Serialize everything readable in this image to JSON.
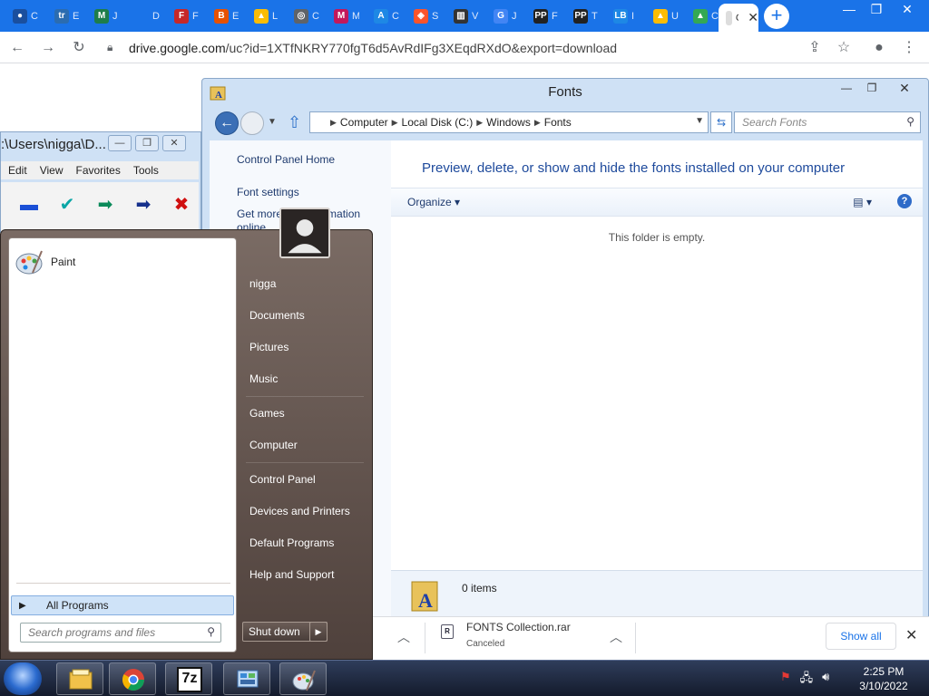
{
  "browser": {
    "tabs": [
      {
        "title": "C",
        "favicon": "gamepad-icon",
        "color": "#1a4f9e",
        "glyph": "●"
      },
      {
        "title": "E",
        "favicon": "trello-icon",
        "color": "#2b6cb0",
        "glyph": "tr"
      },
      {
        "title": "J",
        "favicon": "m-logo-icon",
        "color": "#1e7d4a",
        "glyph": "M"
      },
      {
        "title": "D",
        "favicon": "doc-icon",
        "color": "#1a73e8",
        "glyph": ""
      },
      {
        "title": "F",
        "favicon": "f-logo-icon",
        "color": "#c62828",
        "glyph": "F"
      },
      {
        "title": "E",
        "favicon": "b-logo-icon",
        "color": "#e65100",
        "glyph": "B"
      },
      {
        "title": "L",
        "favicon": "drive-icon",
        "color": "#fbbc04",
        "glyph": "▲"
      },
      {
        "title": "C",
        "favicon": "chrome-icon",
        "color": "#5f6368",
        "glyph": "◎"
      },
      {
        "title": "M",
        "favicon": "m-circle-icon",
        "color": "#c2185b",
        "glyph": "M"
      },
      {
        "title": "C",
        "favicon": "app-store-icon",
        "color": "#1e88e5",
        "glyph": "A"
      },
      {
        "title": "S",
        "favicon": "brave-icon",
        "color": "#fb542b",
        "glyph": "◈"
      },
      {
        "title": "V",
        "favicon": "museum-icon",
        "color": "#333333",
        "glyph": "▥"
      },
      {
        "title": "J",
        "favicon": "google-icon",
        "color": "#4285f4",
        "glyph": "G"
      },
      {
        "title": "F",
        "favicon": "pp-icon",
        "color": "#222222",
        "glyph": "PP"
      },
      {
        "title": "T",
        "favicon": "pp-icon-2",
        "color": "#222222",
        "glyph": "PP"
      },
      {
        "title": "I",
        "favicon": "lb-icon",
        "color": "#1e88e5",
        "glyph": "LB"
      },
      {
        "title": "U",
        "favicon": "drive-icon-2",
        "color": "#fbbc04",
        "glyph": "▲"
      },
      {
        "title": "C",
        "favicon": "drive-icon-3",
        "color": "#34a853",
        "glyph": "▲"
      },
      {
        "title": "G",
        "favicon": "active-tab-icon",
        "color": "#dddddd",
        "glyph": ""
      }
    ],
    "url_prefix": "drive.google.com",
    "url_rest": "/uc?id=1XTfNKRY770fgT6d5AvRdIFg3XEqdRXdO&export=download"
  },
  "explorer_bg": {
    "title": ":\\Users\\nigga\\D...",
    "menu": [
      "Edit",
      "View",
      "Favorites",
      "Tools"
    ]
  },
  "fonts_window": {
    "title": "Fonts",
    "breadcrumb": [
      "Computer",
      "Local Disk (C:)",
      "Windows",
      "Fonts"
    ],
    "search_placeholder": "Search Fonts",
    "left_links": [
      "Control Panel Home",
      "Font settings",
      "Get more font information online"
    ],
    "heading": "Preview, delete, or show and hide the fonts installed on your computer",
    "organize_label": "Organize",
    "empty_message": "This folder is empty.",
    "item_count": "0 items"
  },
  "downloads": {
    "file_name": "FONTS Collection.rar",
    "status": "Canceled",
    "show_all": "Show all",
    "file_icon_glyph": "R"
  },
  "start_menu": {
    "pinned_program": "Paint",
    "all_programs": "All Programs",
    "search_placeholder": "Search programs and files",
    "right_items": [
      "nigga",
      "Documents",
      "Pictures",
      "Music",
      "Games",
      "Computer",
      "Control Panel",
      "Devices and Printers",
      "Default Programs",
      "Help and Support"
    ],
    "shutdown": "Shut down"
  },
  "taskbar": {
    "time": "2:25 PM",
    "date": "3/10/2022",
    "archive_label": "7z"
  }
}
